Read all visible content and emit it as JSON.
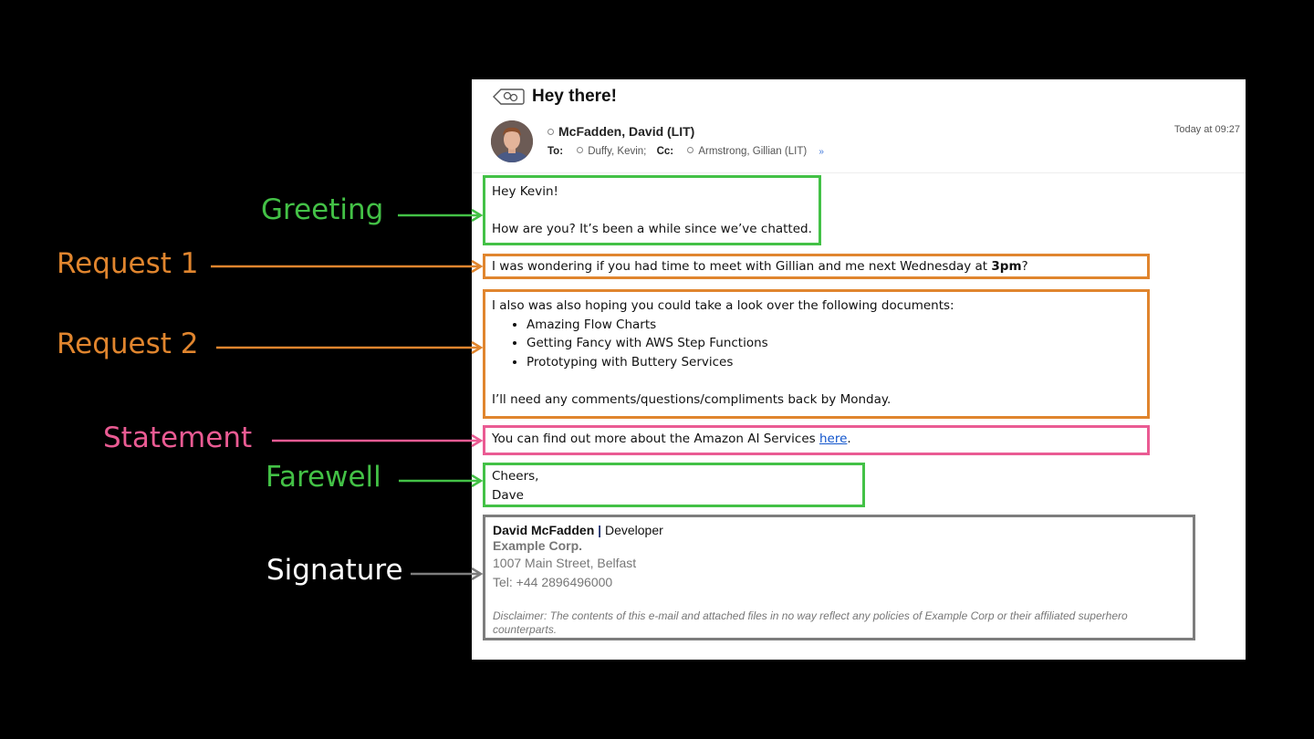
{
  "email": {
    "subject": "Hey there!",
    "sender": "McFadden, David (LIT)",
    "time": "Today at 09:27",
    "to_label": "To:",
    "to_value": "Duffy, Kevin;",
    "cc_label": "Cc:",
    "cc_value": "Armstrong, Gillian (LIT)",
    "expand_glyph": "»"
  },
  "body": {
    "greeting_line1": "Hey Kevin!",
    "greeting_line2": "How are you? It’s been a while since we’ve chatted.",
    "request1_pre": "I was wondering if you had time to meet with Gillian and me next Wednesday at ",
    "request1_bold": "3pm",
    "request1_post": "?",
    "request2_intro": "I also was also hoping you could take a look over the following documents:",
    "documents": [
      "Amazing Flow Charts",
      "Getting Fancy with AWS Step Functions",
      "Prototyping with Buttery Services"
    ],
    "request2_outro": "I’ll need any comments/questions/compliments back by Monday.",
    "statement_pre": "You can find out more about the Amazon AI Services ",
    "statement_link": "here",
    "statement_post": ".",
    "farewell_line1": "Cheers,",
    "farewell_line2": "Dave"
  },
  "signature": {
    "name": "David McFadden",
    "separator": "|",
    "title": "Developer",
    "company": "Example Corp.",
    "address": "1007 Main Street, Belfast",
    "tel": "Tel: +44 2896496000",
    "disclaimer": "Disclaimer: The contents of this e-mail and attached files in no way reflect any policies of Example Corp or their affiliated superhero counterparts."
  },
  "annotations": {
    "greeting": "Greeting",
    "request1": "Request 1",
    "request2": "Request 2",
    "statement": "Statement",
    "farewell": "Farewell",
    "signature": "Signature"
  },
  "colors": {
    "green": "#43c146",
    "orange": "#e0852e",
    "pink": "#ea5b93",
    "grey": "#7d7d7d",
    "white": "#ffffff"
  }
}
